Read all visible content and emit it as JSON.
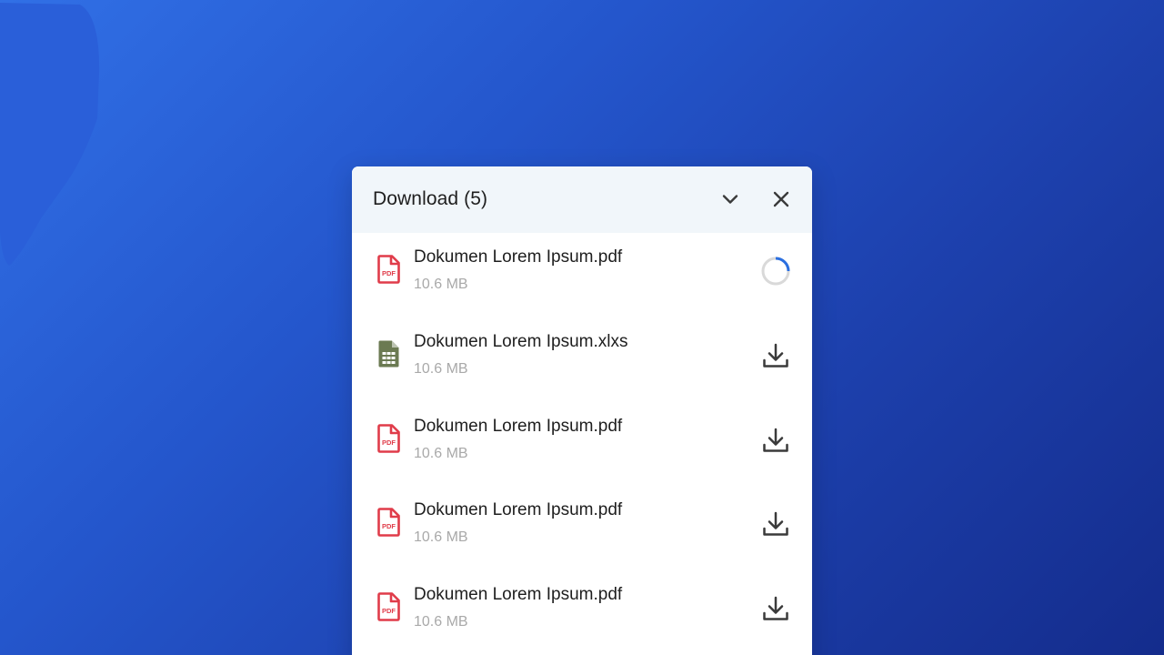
{
  "panel": {
    "title": "Download (5)",
    "collapse_icon": "chevron-down-icon",
    "close_icon": "close-icon"
  },
  "files": [
    {
      "name": "Dokumen Lorem Ipsum.pdf",
      "size": "10.6 MB",
      "type": "pdf",
      "icon": "pdf-file-icon",
      "status": "downloading",
      "action_icon": "progress-spinner-icon",
      "progress": 0.25
    },
    {
      "name": "Dokumen Lorem Ipsum.xlxs",
      "size": "10.6 MB",
      "type": "spreadsheet",
      "icon": "spreadsheet-file-icon",
      "status": "ready",
      "action_icon": "download-icon"
    },
    {
      "name": "Dokumen Lorem Ipsum.pdf",
      "size": "10.6 MB",
      "type": "pdf",
      "icon": "pdf-file-icon",
      "status": "ready",
      "action_icon": "download-icon"
    },
    {
      "name": "Dokumen Lorem Ipsum.pdf",
      "size": "10.6 MB",
      "type": "pdf",
      "icon": "pdf-file-icon",
      "status": "ready",
      "action_icon": "download-icon"
    },
    {
      "name": "Dokumen Lorem Ipsum.pdf",
      "size": "10.6 MB",
      "type": "pdf",
      "icon": "pdf-file-icon",
      "status": "ready",
      "action_icon": "download-icon"
    }
  ],
  "colors": {
    "pdf_icon": "#e03c4a",
    "spreadsheet_icon": "#6b7a52",
    "spinner_track": "#d9d9d9",
    "spinner_progress": "#2b6fe0",
    "header_bg": "#f1f6fa",
    "action_icon": "#3a3a3a"
  }
}
